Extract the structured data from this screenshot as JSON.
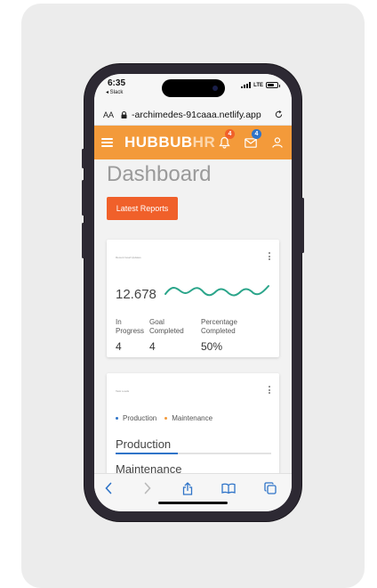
{
  "status_bar": {
    "time": "6:35",
    "back_app": "◂ Slack",
    "network": "LTE"
  },
  "browser": {
    "text_size_label": "AA",
    "url": "-archimedes-91caaa.netlify.app"
  },
  "app_bar": {
    "brand_part1": "HUBBUB",
    "brand_part2": "HR",
    "notifications_count": "4",
    "messages_count": "4"
  },
  "colors": {
    "app_bar": "#f39a3a",
    "primary_button": "#f0602a",
    "notification_badge": "#f0602a",
    "message_badge": "#2f74c8",
    "sparkline": "#2ba58a",
    "tab_active": "#2f74c8"
  },
  "page": {
    "title": "Dashboard",
    "latest_reports_button": "Latest Reports"
  },
  "summary_card": {
    "label": "Recent Goal Updates",
    "value": "12.678",
    "stats": [
      {
        "label": "In Progress",
        "value": "4"
      },
      {
        "label": "Goal Completed",
        "value": "4"
      },
      {
        "label": "Percentage Completed",
        "value": "50%"
      }
    ]
  },
  "tasks_card": {
    "label": "Task Loads",
    "legend": [
      {
        "name": "Production",
        "color": "#2f74c8"
      },
      {
        "name": "Maintenance",
        "color": "#f39a3a"
      }
    ],
    "tabs": [
      {
        "label": "Production"
      },
      {
        "label": "Maintenance"
      }
    ]
  },
  "icons": [
    "back-icon",
    "forward-icon",
    "share-icon",
    "bookmarks-icon",
    "tabs-icon",
    "bell-icon",
    "mail-icon",
    "user-icon",
    "lock-icon",
    "reload-icon",
    "menu-icon"
  ]
}
